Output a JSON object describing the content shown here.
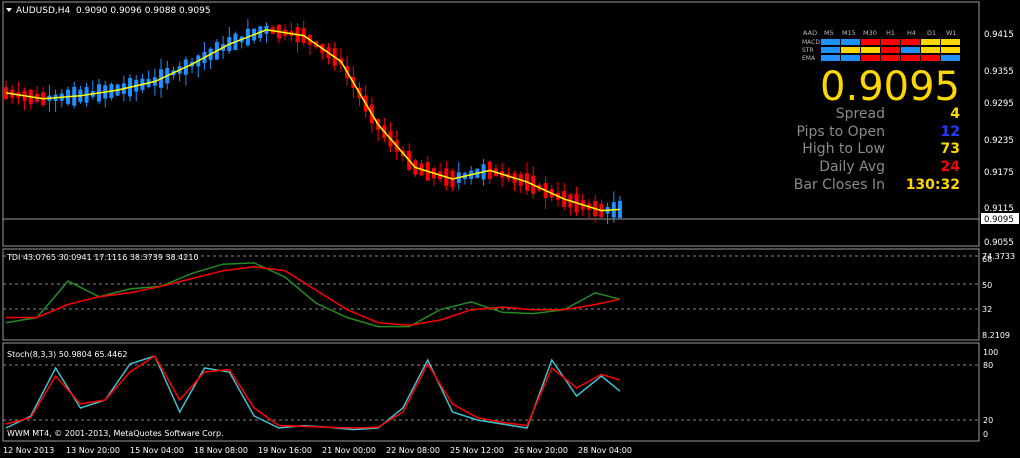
{
  "main": {
    "symbol_label": "AUDUSD,H4",
    "ohlc_label": "0.9090 0.9096 0.9088 0.9095",
    "price_ticks": [
      "0.9415",
      "0.9355",
      "0.9295",
      "0.9235",
      "0.9175",
      "0.9115",
      "0.9055"
    ],
    "current_price_label": "0.9095",
    "ylim": [
      0.904,
      0.946
    ]
  },
  "mtf_panel": {
    "timeframes": [
      "AAD",
      "M5",
      "M15",
      "M30",
      "H1",
      "H4",
      "D1",
      "W1"
    ],
    "rows": [
      {
        "label": "MACD",
        "colors": [
          "#1e90ff",
          "#1e90ff",
          "#ff0000",
          "#ff0000",
          "#ff0000",
          "#ffd700",
          "#ffd700"
        ]
      },
      {
        "label": "STR",
        "colors": [
          "#1e90ff",
          "#ffd700",
          "#ffd700",
          "#ff0000",
          "#1e90ff",
          "#ffd700",
          "#ffd700"
        ]
      },
      {
        "label": "EMA",
        "colors": [
          "#1e90ff",
          "#1e90ff",
          "#ff0000",
          "#ff0000",
          "#ff0000",
          "#ff0000",
          "#1e90ff"
        ]
      }
    ]
  },
  "info": {
    "big_price": "0.9095",
    "rows": [
      {
        "label": "Spread",
        "value": "4",
        "color": "#ffd700"
      },
      {
        "label": "Pips to Open",
        "value": "12",
        "color": "#1e3cff"
      },
      {
        "label": "High to Low",
        "value": "73",
        "color": "#ffd700"
      },
      {
        "label": "Daily Avg",
        "value": "24",
        "color": "#ff0000"
      },
      {
        "label": "Bar Closes In",
        "value": "130:32",
        "color": "#ffd700"
      }
    ]
  },
  "tdi": {
    "label": "TDI 43.0765 30.0941 17.1116 38.3739 38.4210",
    "ticks": [
      "74.3733",
      "68",
      "50",
      "32",
      "8.2109"
    ]
  },
  "stoch": {
    "label": "Stoch(8,3,3) 50.9804 65.4462",
    "ticks": [
      "100",
      "80",
      "20",
      "0"
    ]
  },
  "copyright": "WWM MT4, © 2001-2013, MetaQuotes Software Corp.",
  "time_axis": [
    "12 Nov 2013",
    "13 Nov 20:00",
    "15 Nov 04:00",
    "18 Nov 08:00",
    "19 Nov 16:00",
    "21 Nov 00:00",
    "22 Nov 08:00",
    "25 Nov 12:00",
    "26 Nov 20:00",
    "28 Nov 04:00"
  ],
  "chart_data": [
    {
      "type": "line",
      "title": "AUDUSD,H4",
      "series": [
        {
          "name": "",
          "x": [
            0,
            6,
            12,
            18,
            24,
            30,
            36,
            42,
            48,
            54,
            60,
            66,
            72,
            78,
            84,
            90,
            96,
            99
          ],
          "values": [
            0.9305,
            0.9295,
            0.93,
            0.931,
            0.9325,
            0.9355,
            0.939,
            0.9415,
            0.9405,
            0.936,
            0.925,
            0.9175,
            0.9155,
            0.917,
            0.915,
            0.912,
            0.91,
            0.9102
          ]
        }
      ],
      "ylim": [
        0.904,
        0.946
      ]
    },
    {
      "type": "line",
      "title": "TDI 43.0765 30.0941 17.1116 38.3739 38.4210",
      "series": [
        {
          "name": "",
          "x": [
            0,
            5,
            10,
            15,
            20,
            25,
            30,
            35,
            40,
            45,
            50,
            55,
            60,
            65,
            70,
            75,
            80,
            85,
            90,
            95,
            99
          ],
          "values": [
            20,
            24,
            52,
            40,
            46,
            48,
            58,
            65,
            66,
            55,
            35,
            24,
            17,
            17,
            30,
            36,
            28,
            27,
            30,
            43,
            38
          ]
        },
        {
          "name": "",
          "x": [
            0,
            5,
            10,
            15,
            20,
            25,
            30,
            35,
            40,
            45,
            50,
            55,
            60,
            65,
            70,
            75,
            80,
            85,
            90,
            95,
            99
          ],
          "values": [
            24,
            24,
            34,
            40,
            43,
            48,
            54,
            60,
            63,
            60,
            45,
            30,
            20,
            18,
            22,
            30,
            32,
            30,
            30,
            34,
            38
          ]
        }
      ],
      "ylim": [
        8.2109,
        74.3733
      ]
    },
    {
      "type": "line",
      "title": "Stoch(8,3,3) 50.9804 65.4462",
      "series": [
        {
          "name": "",
          "x": [
            0,
            4,
            8,
            12,
            16,
            20,
            24,
            28,
            32,
            36,
            40,
            44,
            48,
            52,
            56,
            60,
            64,
            68,
            72,
            76,
            80,
            84,
            88,
            92,
            96,
            99
          ],
          "values": [
            5,
            20,
            80,
            30,
            40,
            85,
            95,
            25,
            80,
            75,
            20,
            5,
            8,
            6,
            3,
            5,
            30,
            90,
            25,
            15,
            10,
            5,
            90,
            45,
            70,
            51
          ]
        },
        {
          "name": "",
          "x": [
            0,
            4,
            8,
            12,
            16,
            20,
            24,
            28,
            32,
            36,
            40,
            44,
            48,
            52,
            56,
            60,
            64,
            68,
            72,
            76,
            80,
            84,
            88,
            92,
            96,
            99
          ],
          "values": [
            10,
            18,
            70,
            35,
            40,
            75,
            95,
            40,
            75,
            78,
            30,
            8,
            7,
            6,
            5,
            6,
            25,
            85,
            35,
            18,
            12,
            8,
            80,
            55,
            72,
            65
          ]
        }
      ],
      "ylim": [
        0,
        100
      ]
    }
  ]
}
